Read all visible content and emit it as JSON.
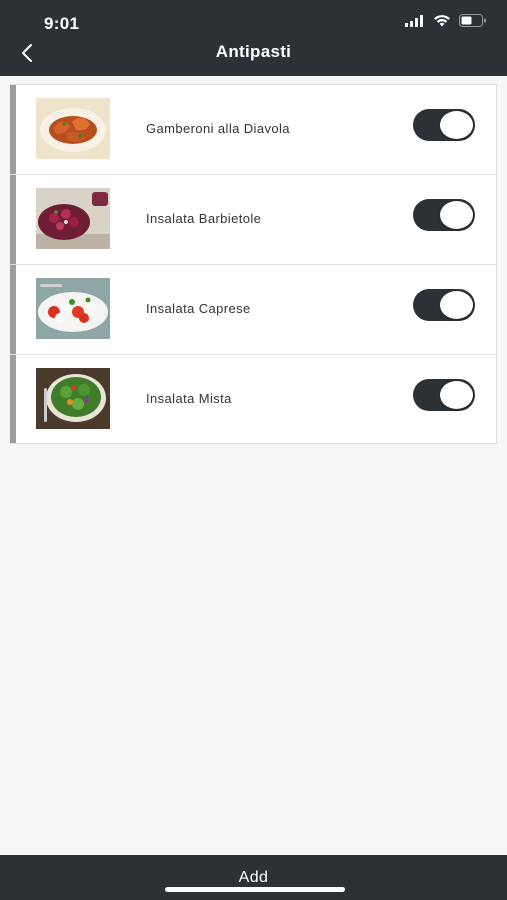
{
  "status_bar": {
    "time": "9:01",
    "icons": [
      "signal-icon",
      "wifi-icon",
      "battery-icon"
    ]
  },
  "nav": {
    "title": "Antipasti",
    "back_icon": "chevron-left-icon"
  },
  "items": [
    {
      "label": "Gamberoni alla Diavola",
      "enabled": true
    },
    {
      "label": "Insalata Barbietole",
      "enabled": true
    },
    {
      "label": "Insalata Caprese",
      "enabled": true
    },
    {
      "label": "Insalata Mista",
      "enabled": true
    }
  ],
  "footer": {
    "add_label": "Add"
  },
  "colors": {
    "bar_background": "#2b3135",
    "page_background": "#f7f7f7",
    "list_accent": "#9e9e9e",
    "toggle_on": "#2b3135"
  }
}
